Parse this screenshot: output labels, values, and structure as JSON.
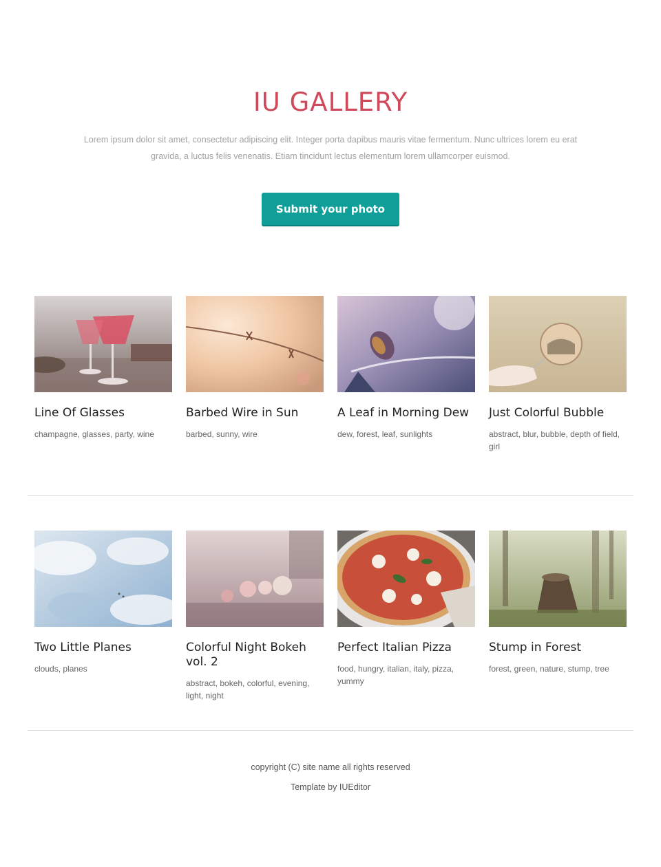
{
  "header": {
    "title": "IU GALLERY",
    "intro": "Lorem ipsum dolor sit amet, consectetur adipiscing elit. Integer porta dapibus mauris vitae fermentum. Nunc ultrices lorem eu erat gravida, a luctus felis venenatis. Etiam tincidunt lectus elementum lorem ullamcorper euismod.",
    "submit_label": "Submit your photo"
  },
  "colors": {
    "accent": "#d0495a",
    "button": "#0f9e98"
  },
  "gallery": [
    {
      "title": "Line Of Glasses",
      "tags": "champagne, glasses, party, wine",
      "image": "wine-glasses-photo"
    },
    {
      "title": "Barbed Wire in Sun",
      "tags": "barbed, sunny, wire",
      "image": "barbed-wire-photo"
    },
    {
      "title": "A Leaf in Morning Dew",
      "tags": "dew, forest, leaf, sunlights",
      "image": "dewy-leaf-photo"
    },
    {
      "title": "Just Colorful Bubble",
      "tags": "abstract, blur, bubble, depth of field, girl",
      "image": "bubble-photo"
    },
    {
      "title": "Two Little Planes",
      "tags": "clouds, planes",
      "image": "sky-planes-photo"
    },
    {
      "title": "Colorful Night Bokeh vol. 2",
      "tags": "abstract, bokeh, colorful, evening, light, night",
      "image": "night-bokeh-photo"
    },
    {
      "title": "Perfect Italian Pizza",
      "tags": "food, hungry, italian, italy, pizza, yummy",
      "image": "pizza-photo"
    },
    {
      "title": "Stump in Forest",
      "tags": "forest, green, nature, stump, tree",
      "image": "forest-stump-photo"
    }
  ],
  "footer": {
    "copyright": "copyright (C) site name all rights reserved",
    "credit": "Template by IUEditor"
  }
}
